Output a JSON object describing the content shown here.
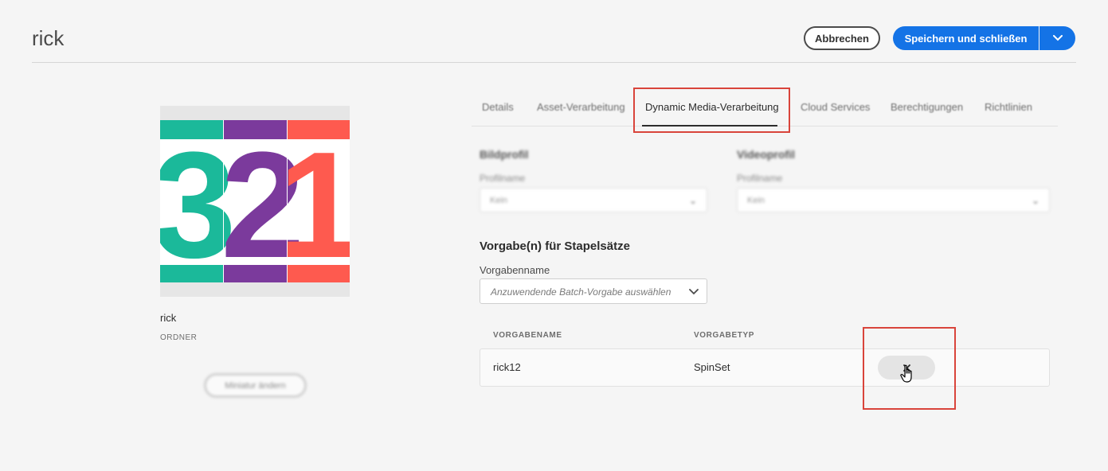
{
  "header": {
    "title": "rick",
    "cancel_label": "Abbrechen",
    "save_label": "Speichern und schließen"
  },
  "folder": {
    "name": "rick",
    "type": "ORDNER",
    "thumbnail_digits": [
      "3",
      "2",
      "1"
    ],
    "thumbnail_colors": [
      "#1bb99a",
      "#7b3a9c",
      "#fe5a4f"
    ],
    "change_thumbnail_label": "Miniatur ändern"
  },
  "tabs": [
    {
      "label": "Details"
    },
    {
      "label": "Asset-Verarbeitung"
    },
    {
      "label": "Dynamic Media-Verarbeitung",
      "active": true
    },
    {
      "label": "Cloud Services"
    },
    {
      "label": "Berechtigungen"
    },
    {
      "label": "Richtlinien"
    }
  ],
  "profiles": {
    "image": {
      "heading": "Bildprofil",
      "label": "Profilname",
      "value": "Kein"
    },
    "video": {
      "heading": "Videoprofil",
      "label": "Profilname",
      "value": "Kein"
    }
  },
  "batch": {
    "title": "Vorgabe(n) für Stapelsätze",
    "name_label": "Vorgabenname",
    "placeholder": "Anzuwendende Batch-Vorgabe auswählen",
    "columns": [
      "VORGABENAME",
      "VORGABETYP"
    ],
    "rows": [
      {
        "name": "rick12",
        "type": "SpinSet"
      }
    ]
  },
  "colors": {
    "accent": "#1473e6",
    "highlight": "#d9443b"
  }
}
